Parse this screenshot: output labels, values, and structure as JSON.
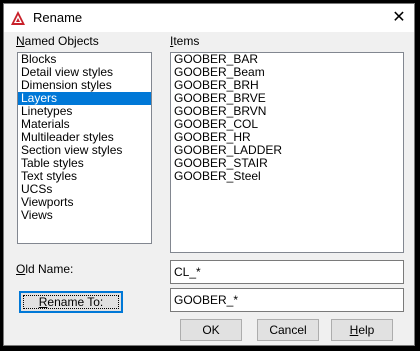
{
  "window": {
    "title": "Rename",
    "close_glyph": "✕",
    "icon": "autocad-icon"
  },
  "named_objects": {
    "label_underlined": "N",
    "label_rest": "amed Objects",
    "items": [
      "Blocks",
      "Detail view styles",
      "Dimension styles",
      "Layers",
      "Linetypes",
      "Materials",
      "Multileader styles",
      "Section view styles",
      "Table styles",
      "Text styles",
      "UCSs",
      "Viewports",
      "Views"
    ],
    "selected_index": 3
  },
  "items_list": {
    "label_underlined": "I",
    "label_rest": "tems",
    "items": [
      "GOOBER_BAR",
      "GOOBER_Beam",
      "GOOBER_BRH",
      "GOOBER_BRVE",
      "GOOBER_BRVN",
      "GOOBER_COL",
      "GOOBER_HR",
      "GOOBER_LADDER",
      "GOOBER_STAIR",
      "GOOBER_Steel"
    ]
  },
  "old_name": {
    "label_underlined": "O",
    "label_rest": "ld Name:",
    "value": "CL_*"
  },
  "rename_to": {
    "label_underlined": "R",
    "label_rest": "ename To:",
    "value": "GOOBER_*"
  },
  "buttons": {
    "ok": "OK",
    "cancel": "Cancel",
    "help_underlined": "H",
    "help_rest": "elp"
  },
  "colors": {
    "accent": "#0078d7",
    "icon_red": "#c8202a"
  }
}
